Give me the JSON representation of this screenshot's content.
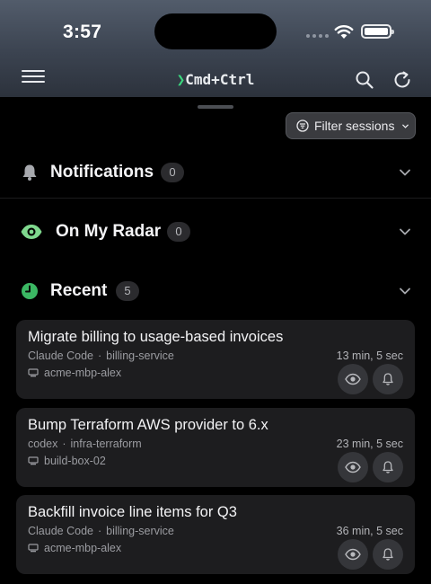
{
  "status_bar": {
    "time": "3:57"
  },
  "header": {
    "brand_prompt": "❯",
    "brand_name": "Cmd+Ctrl",
    "menu_icon": "hamburger-menu-icon",
    "search_icon": "search-icon",
    "refresh_icon": "refresh-icon"
  },
  "filter": {
    "label": "Filter sessions",
    "icon": "filter-icon"
  },
  "sections": {
    "notifications": {
      "title": "Notifications",
      "count": "0",
      "icon": "bell-icon"
    },
    "radar": {
      "title": "On My Radar",
      "count": "0",
      "icon": "eye-icon"
    },
    "recent": {
      "title": "Recent",
      "count": "5",
      "icon": "clock-icon"
    }
  },
  "sessions": [
    {
      "title": "Migrate billing to usage-based invoices",
      "agent": "Claude Code",
      "repo": "billing-service",
      "host": "acme-mbp-alex",
      "elapsed": "13 min, 5 sec"
    },
    {
      "title": "Bump Terraform AWS provider to 6.x",
      "agent": "codex",
      "repo": "infra-terraform",
      "host": "build-box-02",
      "elapsed": "23 min, 5 sec"
    },
    {
      "title": "Backfill invoice line items for Q3",
      "agent": "Claude Code",
      "repo": "billing-service",
      "host": "acme-mbp-alex",
      "elapsed": "36 min, 5 sec"
    }
  ],
  "colors": {
    "accent_green": "#3bd67e",
    "radar_green": "#7fd88e",
    "background": "#000000",
    "card": "#1d1d1f"
  }
}
